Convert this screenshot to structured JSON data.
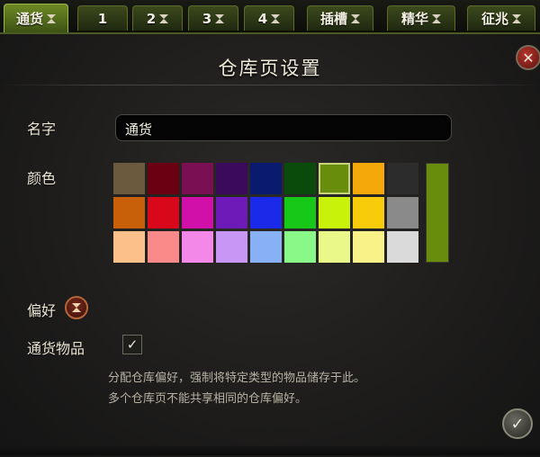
{
  "tabs": [
    {
      "label": "通货",
      "hourglass": true,
      "active": true
    },
    {
      "label": "1",
      "hourglass": false,
      "active": false
    },
    {
      "label": "2",
      "hourglass": true,
      "active": false
    },
    {
      "label": "3",
      "hourglass": true,
      "active": false
    },
    {
      "label": "4",
      "hourglass": true,
      "active": false
    },
    {
      "label": "插槽",
      "hourglass": true,
      "active": false
    },
    {
      "label": "精华",
      "hourglass": true,
      "active": false
    },
    {
      "label": "征兆",
      "hourglass": true,
      "active": false
    }
  ],
  "dialog": {
    "title": "仓库页设置",
    "name_label": "名字",
    "name_value": "通货",
    "color_label": "颜色",
    "preference_label": "偏好",
    "currency_items_label": "通货物品",
    "currency_items_checked": true,
    "description_line1": "分配仓库偏好，强制将特定类型的物品储存于此。",
    "description_line2": "多个仓库页不能共享相同的仓库偏好。",
    "close_glyph": "✕",
    "confirm_glyph": "✓",
    "check_glyph": "✓"
  },
  "icons": {
    "tab_hourglass": "hourglass-icon",
    "close": "close-icon",
    "preference": "hourglass-icon",
    "confirm": "checkmark-icon"
  },
  "colors": {
    "selected": "#688c0c",
    "swatches": [
      [
        "#6b5a3e",
        "#6a0012",
        "#7a0f54",
        "#3c0a5c",
        "#0a1a6e",
        "#0a4a0a",
        "#688c0c",
        "#f4a80a",
        "#2c2c2c"
      ],
      [
        "#c8600a",
        "#d8081a",
        "#d010a8",
        "#6e1ab8",
        "#1a2ae8",
        "#18c818",
        "#c8f20a",
        "#f8cc0a",
        "#8a8a8a"
      ],
      [
        "#fcc08a",
        "#fa8a8a",
        "#f488e8",
        "#c896f4",
        "#88b0f4",
        "#8af888",
        "#eaf88a",
        "#f8f288",
        "#dadada"
      ]
    ],
    "selected_index": [
      0,
      6
    ]
  }
}
